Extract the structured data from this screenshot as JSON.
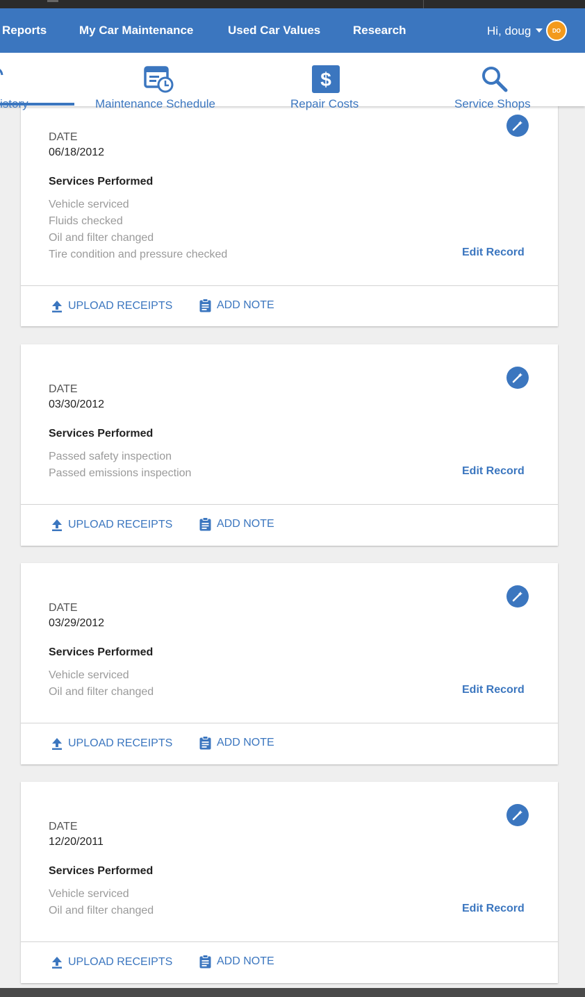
{
  "nav": {
    "links": [
      "Reports",
      "My Car Maintenance",
      "Used Car Values",
      "Research"
    ],
    "greeting": "Hi, doug",
    "avatar_initials": "DO",
    "brand_color": "#3b76bf",
    "avatar_color": "#f39a1d"
  },
  "tabs": [
    {
      "label": "istory",
      "icon": "history-icon",
      "active": true
    },
    {
      "label": "Maintenance Schedule",
      "icon": "calendar-clock-icon",
      "active": false
    },
    {
      "label": "Repair Costs",
      "icon": "dollar-icon",
      "active": false
    },
    {
      "label": "Service Shops",
      "icon": "search-icon",
      "active": false
    }
  ],
  "labels": {
    "date": "DATE",
    "services": "Services Performed",
    "edit": "Edit Record",
    "upload": "UPLOAD RECEIPTS",
    "note": "ADD NOTE"
  },
  "records": [
    {
      "date": "06/18/2012",
      "services": [
        "Vehicle serviced",
        "Fluids checked",
        "Oil and filter changed",
        "Tire condition and pressure checked"
      ]
    },
    {
      "date": "03/30/2012",
      "services": [
        "Passed safety inspection",
        "Passed emissions inspection"
      ]
    },
    {
      "date": "03/29/2012",
      "services": [
        "Vehicle serviced",
        "Oil and filter changed"
      ]
    },
    {
      "date": "12/20/2011",
      "services": [
        "Vehicle serviced",
        "Oil and filter changed"
      ]
    }
  ]
}
